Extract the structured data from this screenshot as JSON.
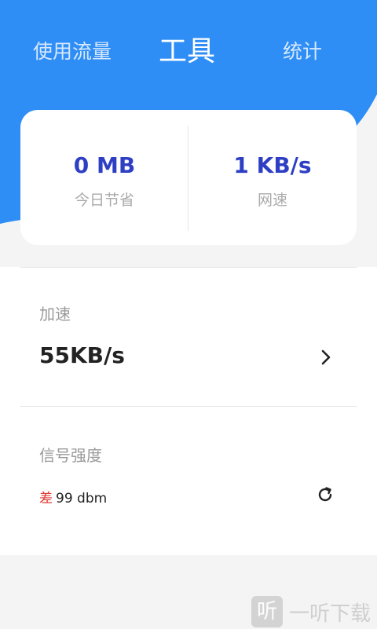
{
  "colors": {
    "accent": "#2e8ef5",
    "stat_value": "#2e3fc4",
    "signal_bad": "#e03a30"
  },
  "tabs": [
    {
      "label": "使用流量"
    },
    {
      "label": "工具",
      "active": true
    },
    {
      "label": "统计"
    }
  ],
  "stats": {
    "saved_today": {
      "value": "0 MB",
      "label": "今日节省"
    },
    "net_speed": {
      "value": "1 KB/s",
      "label": "网速"
    }
  },
  "speedup": {
    "title": "加速",
    "value": "55KB/s",
    "icon": "chevron-right-icon"
  },
  "signal": {
    "title": "信号强度",
    "quality": "差",
    "dbm": "99 dbm",
    "icon": "refresh-icon"
  },
  "watermark": {
    "glyph": "听",
    "text": "一听下载"
  }
}
